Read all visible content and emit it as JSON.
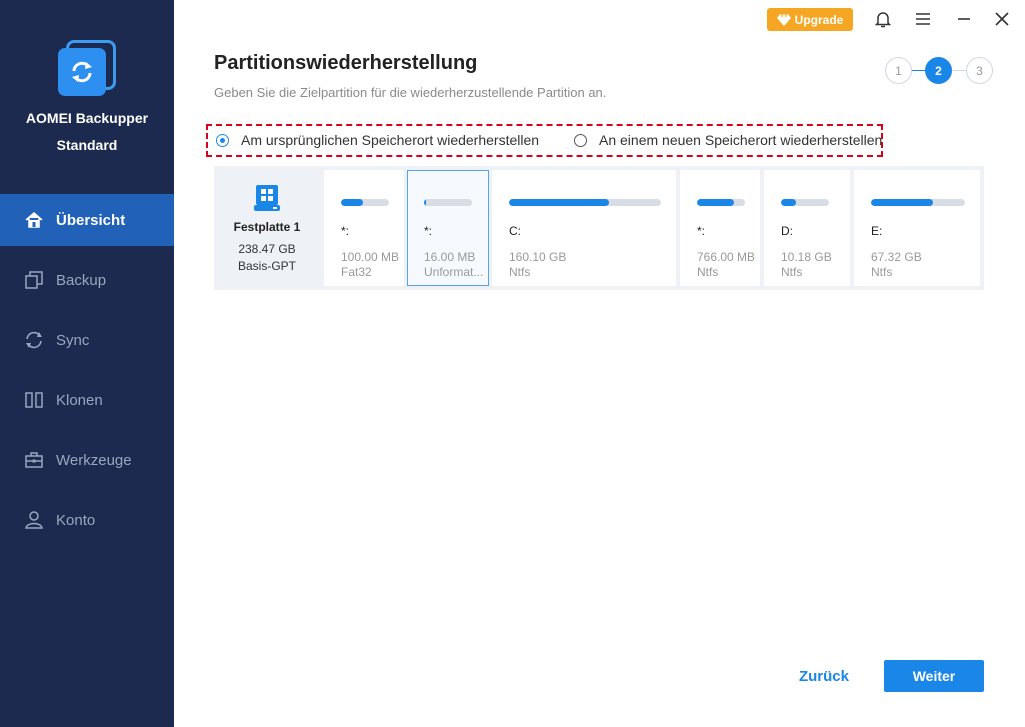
{
  "app": {
    "name": "AOMEI Backupper",
    "edition": "Standard"
  },
  "sidebar": {
    "items": [
      {
        "label": "Übersicht",
        "icon": "home-icon",
        "active": true
      },
      {
        "label": "Backup",
        "icon": "backup-icon",
        "active": false
      },
      {
        "label": "Sync",
        "icon": "sync-icon",
        "active": false
      },
      {
        "label": "Klonen",
        "icon": "clone-icon",
        "active": false
      },
      {
        "label": "Werkzeuge",
        "icon": "toolbox-icon",
        "active": false
      },
      {
        "label": "Konto",
        "icon": "user-icon",
        "active": false
      }
    ]
  },
  "titlebar": {
    "upgrade_label": "Upgrade"
  },
  "header": {
    "title": "Partitionswiederherstellung",
    "subtitle": "Geben Sie die Zielpartition für die wiederherzustellende Partition an."
  },
  "steps": [
    "1",
    "2",
    "3"
  ],
  "options": {
    "original": "Am ursprünglichen Speicherort wiederherstellen",
    "new_location": "An einem neuen Speicherort wiederherstellen",
    "selected": "original"
  },
  "disk": {
    "name": "Festplatte 1",
    "size": "238.47 GB",
    "type": "Basis-GPT"
  },
  "partitions": [
    {
      "label": "*:",
      "size": "100.00 MB",
      "fs": "Fat32",
      "used": 0.45
    },
    {
      "label": "*:",
      "size": "16.00 MB",
      "fs": "Unformat...",
      "used": 0.05
    },
    {
      "label": "C:",
      "size": "160.10 GB",
      "fs": "Ntfs",
      "used": 0.66
    },
    {
      "label": "*:",
      "size": "766.00 MB",
      "fs": "Ntfs",
      "used": 0.78
    },
    {
      "label": "D:",
      "size": "10.18 GB",
      "fs": "Ntfs",
      "used": 0.32
    },
    {
      "label": "E:",
      "size": "67.32 GB",
      "fs": "Ntfs",
      "used": 0.66
    }
  ],
  "buttons": {
    "back": "Zurück",
    "next": "Weiter"
  },
  "colors": {
    "accent": "#1a87e8",
    "sidebar": "#1b2a4e",
    "upgrade": "#f5a623",
    "highlight_border": "#d9001b"
  }
}
